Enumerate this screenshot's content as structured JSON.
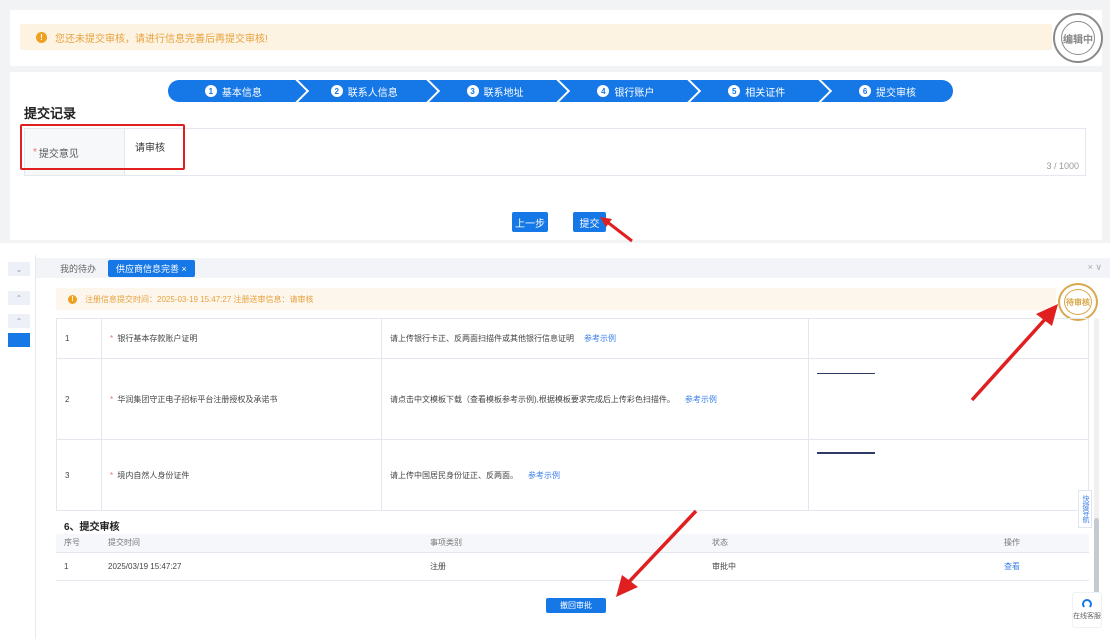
{
  "top": {
    "warning": "您还未提交审核，请进行信息完善后再提交审核!",
    "stamp": "编辑中",
    "steps": [
      {
        "num": "1",
        "label": "基本信息"
      },
      {
        "num": "2",
        "label": "联系人信息"
      },
      {
        "num": "3",
        "label": "联系地址"
      },
      {
        "num": "4",
        "label": "银行账户"
      },
      {
        "num": "5",
        "label": "相关证件"
      },
      {
        "num": "6",
        "label": "提交审核"
      }
    ],
    "section_title": "提交记录",
    "remark_label": "提交意见",
    "remark_required": "*",
    "remark_value": "请审核",
    "counter": "3 / 1000",
    "prev_button": "上一步",
    "submit_button": "提交"
  },
  "bottom": {
    "tabs": [
      "我的待办",
      "供应商信息完善 ×"
    ],
    "window_controls": "× ∨",
    "info": "注册信息提交时间：2025-03-19 15:47:27 注册送审信息：请审核",
    "stamp": "待审核",
    "documents": [
      {
        "no": "1",
        "name": "银行基本存款账户证明",
        "desc": "请上传银行卡正、反两面扫描件或其他银行信息证明",
        "link": "参考示例"
      },
      {
        "no": "2",
        "name": "华润集团守正电子招标平台注册授权及承诺书",
        "desc": "请点击中文模板下载（查看模板参考示例),根据模板要求完成后上传彩色扫描件。",
        "link": "参考示例"
      },
      {
        "no": "3",
        "name": "境内自然人身份证件",
        "desc": "请上传中国居民身份证正、反两面。",
        "link": "参考示例"
      }
    ],
    "record_title": "6、提交审核",
    "record_headers": [
      "序号",
      "提交时间",
      "事项类别",
      "状态",
      "操作"
    ],
    "records": [
      {
        "no": "1",
        "time": "2025/03/19 15:47:27",
        "type": "注册",
        "status": "审批中",
        "action": "查看"
      }
    ],
    "withdraw_button": "撤回审批",
    "quick_nav": "快捷导航",
    "service": "在线客服"
  },
  "colors": {
    "primary": "#1677e6",
    "warning": "#e6a23c",
    "annotation": "#e02020"
  }
}
